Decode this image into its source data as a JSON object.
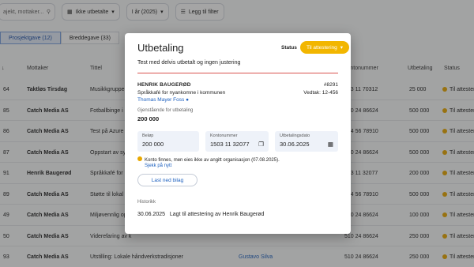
{
  "toolbar": {
    "search_placeholder": "ajekt, mottaker...",
    "filter_paid": "Ikke utbetalte",
    "filter_year": "I år (2025)",
    "add_filter": "Legg til filter"
  },
  "tabs": [
    "Prosjektgave (12)",
    "Breddegave (33)"
  ],
  "columns": {
    "mottaker": "Mottaker",
    "tittel": "Tittel",
    "kontonummer": "kontonummer",
    "utbetaling": "Utbetaling",
    "status": "Status"
  },
  "rows": [
    {
      "id": "64",
      "mottaker": "Taktløs Tirsdag",
      "tittel": "Musikkgruppe for",
      "kontonummer": "503 11 70312",
      "utbetaling": "25 000",
      "status": "Til attester"
    },
    {
      "id": "85",
      "mottaker": "Catch Media AS",
      "tittel": "Fotballbinge i Ha",
      "kontonummer": "510 24 86624",
      "utbetaling": "500 000",
      "status": "Til attester"
    },
    {
      "id": "86",
      "mottaker": "Catch Media AS",
      "tittel": "Test på Azure",
      "kontonummer": "234 56 78910",
      "utbetaling": "500 000",
      "status": "Til attester"
    },
    {
      "id": "87",
      "mottaker": "Catch Media AS",
      "tittel": "Oppstart av sykk",
      "kontonummer": "510 24 86624",
      "utbetaling": "500 000",
      "status": "Til attester"
    },
    {
      "id": "91",
      "mottaker": "Henrik Baugerød",
      "tittel": "Språkkafé for nya",
      "kontonummer": "503 11 32077",
      "utbetaling": "200 000",
      "status": "Til attester"
    },
    {
      "id": "89",
      "mottaker": "Catch Media AS",
      "tittel": "Støtte til lokal m",
      "kontonummer": "234 56 78910",
      "utbetaling": "500 000",
      "status": "Til attester"
    },
    {
      "id": "49",
      "mottaker": "Catch Media AS",
      "tittel": "Miljøvennlig opp",
      "kontonummer": "510 24 86624",
      "utbetaling": "100 000",
      "status": "Til attester"
    },
    {
      "id": "50",
      "mottaker": "Catch Media AS",
      "tittel": "Viderefaring av k",
      "kontonummer": "510 24 86624",
      "utbetaling": "250 000",
      "status": "Til attester"
    },
    {
      "id": "93",
      "mottaker": "Catch Media AS",
      "tittel": "Utstilling: Lokale håndverkstradisjoner",
      "extra": "Gustavo Silva",
      "kontonummer": "510 24 86624",
      "utbetaling": "250 000",
      "status": "Til attester"
    }
  ],
  "modal": {
    "title": "Utbetaling",
    "status_label": "Status",
    "status_value": "Til attestering",
    "description": "Test med delvis utbetalt og ingen justering",
    "recipient": "HENRIK BAUGERØD",
    "case_no": "#8291",
    "project": "Språkkafé for nyankomne i kommunen",
    "vedtak": "Vedtak: 12-456",
    "contact": "Thomas Mayer Foss",
    "remaining_label": "Gjenstående for utbetaling",
    "remaining_value": "200 000",
    "belop_label": "Beløp",
    "belop_value": "200 000",
    "konto_label": "Kontonummer",
    "konto_value": "1503 11 32077",
    "dato_label": "Utbetalingsdato",
    "dato_value": "30.06.2025",
    "warning": "Konto finnes, men eies ikke av angitt organisasjon (07.08.2025).",
    "recheck": "Sjekk på nytt",
    "download": "Last ned bilag",
    "history_label": "Historikk",
    "history_date": "30.06.2025",
    "history_text": "Lagt til attestering av Henrik Baugerød"
  },
  "colors": {
    "accent": "#f2b600",
    "link": "#1b5fbf",
    "danger": "#d9534f"
  }
}
